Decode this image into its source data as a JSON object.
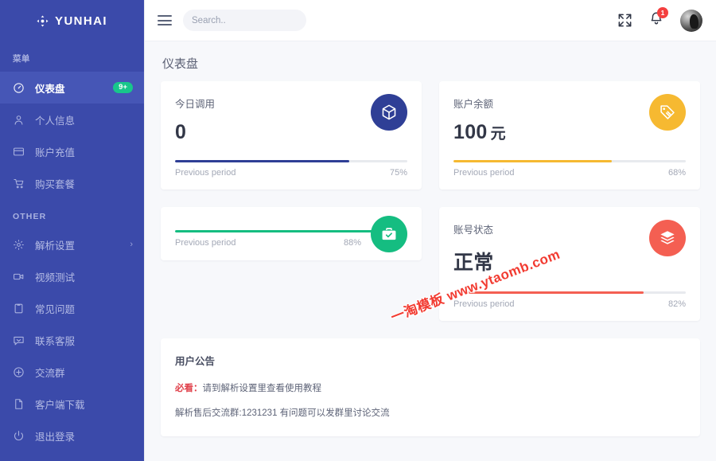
{
  "brand": {
    "name": "YUNHAI",
    "logo_icon": "move-arrows-icon"
  },
  "sidebar": {
    "section_menu_label": "菜单",
    "section_other_label": "OTHER",
    "menu_items": [
      {
        "label": "仪表盘",
        "icon": "dashboard-gauge-icon",
        "badge": "9+",
        "active": true
      },
      {
        "label": "个人信息",
        "icon": "user-icon",
        "badge": "",
        "active": false
      },
      {
        "label": "账户充值",
        "icon": "credit-card-icon",
        "badge": "",
        "active": false
      },
      {
        "label": "购买套餐",
        "icon": "cart-icon",
        "badge": "",
        "active": false
      }
    ],
    "other_items": [
      {
        "label": "解析设置",
        "icon": "gear-icon",
        "chevron": "›"
      },
      {
        "label": "视频测试",
        "icon": "video-camera-icon",
        "chevron": ""
      },
      {
        "label": "常见问题",
        "icon": "clipboard-icon",
        "chevron": ""
      },
      {
        "label": "联系客服",
        "icon": "chat-icon",
        "chevron": ""
      },
      {
        "label": "交流群",
        "icon": "plus-circle-icon",
        "chevron": ""
      },
      {
        "label": "客户端下载",
        "icon": "file-icon",
        "chevron": ""
      },
      {
        "label": "退出登录",
        "icon": "power-icon",
        "chevron": ""
      }
    ]
  },
  "topbar": {
    "menu_toggle_icon": "hamburger-icon",
    "search": {
      "placeholder": "Search..",
      "value": "",
      "icon": "search-icon"
    },
    "fullscreen_icon": "fullscreen-expand-icon",
    "notification": {
      "icon": "bell-icon",
      "count": "1"
    },
    "avatar_icon": "user-avatar"
  },
  "page": {
    "title": "仪表盘"
  },
  "cards": [
    {
      "title": "今日调用",
      "value": "0",
      "unit": "",
      "icon": "cube-box-icon",
      "color": "#2f3f96",
      "progress_label": "Previous period",
      "progress_pct": "75%",
      "progress_value": 75,
      "variant": "full"
    },
    {
      "title": "账户余额",
      "value": "100",
      "unit": "元",
      "icon": "price-tag-icon",
      "color": "#f6b931",
      "progress_label": "Previous period",
      "progress_pct": "68%",
      "progress_value": 68,
      "variant": "full"
    },
    {
      "title": "",
      "value": "",
      "unit": "",
      "icon": "briefcase-check-icon",
      "color": "#15bd81",
      "progress_label": "Previous period",
      "progress_pct": "88%",
      "progress_value": 88,
      "variant": "short"
    },
    {
      "title": "账号状态",
      "value": "正常",
      "unit": "",
      "icon": "layers-stack-icon",
      "color": "#f45f52",
      "progress_label": "Previous period",
      "progress_pct": "82%",
      "progress_value": 82,
      "variant": "full"
    }
  ],
  "notice": {
    "title": "用户公告",
    "line1_emphasis": "必看：",
    "line1_rest": "请到解析设置里查看使用教程",
    "line2": "解析售后交流群:1231231 有问题可以发群里讨论交流"
  },
  "watermark": {
    "text": "一淘模板 www.ytaomb.com"
  }
}
